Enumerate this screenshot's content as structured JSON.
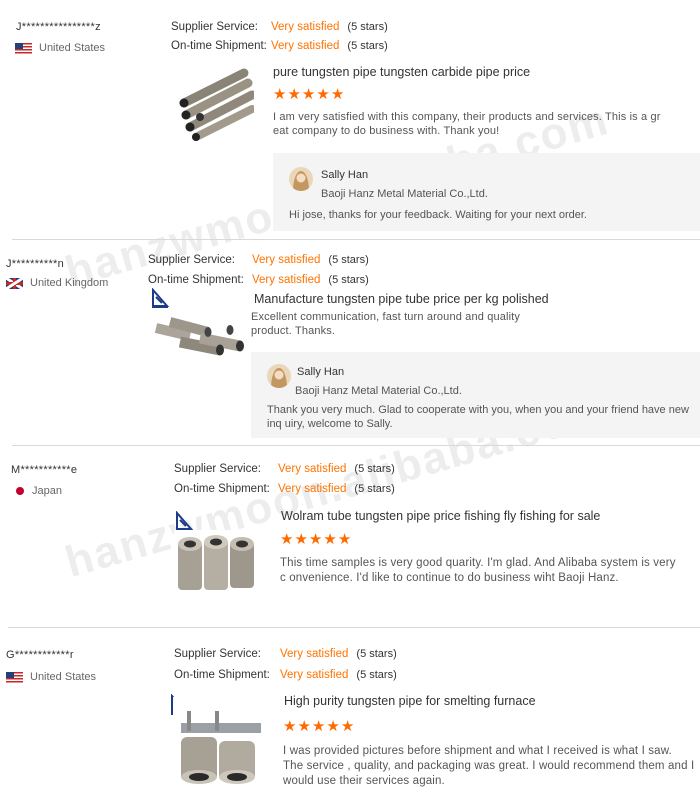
{
  "reviews": [
    {
      "buyer": "J****************z",
      "country": "United States",
      "flag": "us",
      "supplier_service_label": "Supplier Service:",
      "supplier_service_value": "Very satisfied",
      "supplier_service_stars": "(5 stars)",
      "shipment_label": "On-time Shipment:",
      "shipment_value": "Very satisfied",
      "shipment_stars": "(5 stars)",
      "product_title": "pure tungsten pipe tungsten carbide pipe price",
      "rating": 5,
      "comment": "I am very satisfied with this company, their products and services. This is a gr eat company to do business with. Thank you!",
      "reply": {
        "name": "Sally Han",
        "company": "Baoji Hanz Metal Material Co.,Ltd.",
        "text": "Hi jose, thanks for your feedback. Waiting for your next order."
      }
    },
    {
      "buyer": "J**********n",
      "country": "United Kingdom",
      "flag": "uk",
      "supplier_service_label": "Supplier Service:",
      "supplier_service_value": "Very satisfied",
      "supplier_service_stars": "(5 stars)",
      "shipment_label": "On-time Shipment:",
      "shipment_value": "Very satisfied",
      "shipment_stars": "(5 stars)",
      "product_title": "Manufacture tungsten pipe tube price per kg polished",
      "comment": "Excellent communication, fast turn around and quality product. Thanks.",
      "reply": {
        "name": "Sally Han",
        "company": "Baoji Hanz Metal Material Co.,Ltd.",
        "text": "Thank you very much. Glad to cooperate with you, when you and your friend have new inq uiry, welcome to Sally."
      }
    },
    {
      "buyer": "M***********e",
      "country": "Japan",
      "flag": "jp",
      "supplier_service_label": "Supplier Service:",
      "supplier_service_value": "Very satisfied",
      "supplier_service_stars": "(5 stars)",
      "shipment_label": "On-time Shipment:",
      "shipment_value": "Very satisfied",
      "shipment_stars": "(5 stars)",
      "product_title": "Wolram tube tungsten pipe price fishing fly fishing for sale",
      "rating": 5,
      "comment": "This time samples is very good quarity. I'm glad. And Alibaba system is very c onvenience. I'd like to continue to do business wiht Baoji Hanz."
    },
    {
      "buyer": "G************r",
      "country": "United States",
      "flag": "us",
      "supplier_service_label": "Supplier Service:",
      "supplier_service_value": "Very satisfied",
      "supplier_service_stars": "(5 stars)",
      "shipment_label": "On-time Shipment:",
      "shipment_value": "Very satisfied",
      "shipment_stars": "(5 stars)",
      "product_title": "High purity tungsten pipe for smelting furnace",
      "rating": 5,
      "comment": "I was provided pictures before shipment and what I received is what I saw. The service , quality, and packaging was great. I would recommend them and I would use their services again."
    }
  ],
  "watermark": "hanzwmoon.alibaba.com",
  "colors": {
    "accent": "#ff7300",
    "star": "#ff6a00",
    "reply_bg": "#f4f4f4"
  }
}
